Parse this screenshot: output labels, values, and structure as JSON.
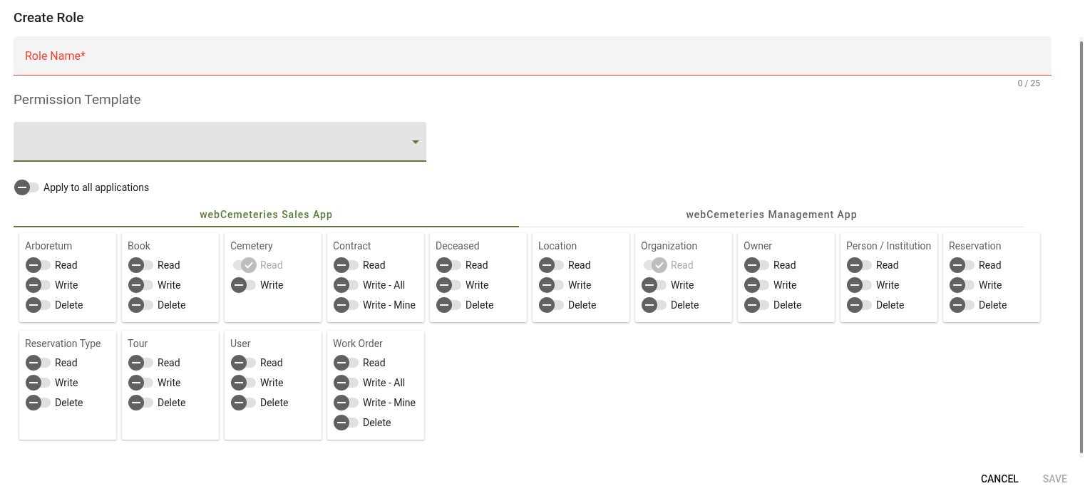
{
  "title": "Create Role",
  "role_name": {
    "label": "Role Name*",
    "counter": "0 / 25",
    "invalid": true
  },
  "permission_template": {
    "heading": "Permission Template"
  },
  "apply_all": {
    "label": "Apply to all applications",
    "checked": false
  },
  "tabs": [
    {
      "label": "webCemeteries Sales App",
      "selected": true
    },
    {
      "label": "webCemeteries Management App",
      "selected": false
    }
  ],
  "cards": [
    {
      "title": "Arboretum",
      "permissions": [
        {
          "label": "Read",
          "checked": false,
          "disabled": false
        },
        {
          "label": "Write",
          "checked": false,
          "disabled": false
        },
        {
          "label": "Delete",
          "checked": false,
          "disabled": false
        }
      ]
    },
    {
      "title": "Book",
      "permissions": [
        {
          "label": "Read",
          "checked": false,
          "disabled": false
        },
        {
          "label": "Write",
          "checked": false,
          "disabled": false
        },
        {
          "label": "Delete",
          "checked": false,
          "disabled": false
        }
      ]
    },
    {
      "title": "Cemetery",
      "permissions": [
        {
          "label": "Read",
          "checked": true,
          "disabled": true
        },
        {
          "label": "Write",
          "checked": false,
          "disabled": false
        }
      ]
    },
    {
      "title": "Contract",
      "permissions": [
        {
          "label": "Read",
          "checked": false,
          "disabled": false
        },
        {
          "label": "Write - All",
          "checked": false,
          "disabled": false
        },
        {
          "label": "Write - Mine",
          "checked": false,
          "disabled": false
        }
      ]
    },
    {
      "title": "Deceased",
      "permissions": [
        {
          "label": "Read",
          "checked": false,
          "disabled": false
        },
        {
          "label": "Write",
          "checked": false,
          "disabled": false
        },
        {
          "label": "Delete",
          "checked": false,
          "disabled": false
        }
      ]
    },
    {
      "title": "Location",
      "permissions": [
        {
          "label": "Read",
          "checked": false,
          "disabled": false
        },
        {
          "label": "Write",
          "checked": false,
          "disabled": false
        },
        {
          "label": "Delete",
          "checked": false,
          "disabled": false
        }
      ]
    },
    {
      "title": "Organization",
      "permissions": [
        {
          "label": "Read",
          "checked": true,
          "disabled": true
        },
        {
          "label": "Write",
          "checked": false,
          "disabled": false
        },
        {
          "label": "Delete",
          "checked": false,
          "disabled": false
        }
      ]
    },
    {
      "title": "Owner",
      "permissions": [
        {
          "label": "Read",
          "checked": false,
          "disabled": false
        },
        {
          "label": "Write",
          "checked": false,
          "disabled": false
        },
        {
          "label": "Delete",
          "checked": false,
          "disabled": false
        }
      ]
    },
    {
      "title": "Person / Institution",
      "permissions": [
        {
          "label": "Read",
          "checked": false,
          "disabled": false
        },
        {
          "label": "Write",
          "checked": false,
          "disabled": false
        },
        {
          "label": "Delete",
          "checked": false,
          "disabled": false
        }
      ]
    },
    {
      "title": "Reservation",
      "permissions": [
        {
          "label": "Read",
          "checked": false,
          "disabled": false
        },
        {
          "label": "Write",
          "checked": false,
          "disabled": false
        },
        {
          "label": "Delete",
          "checked": false,
          "disabled": false
        }
      ]
    },
    {
      "title": "Reservation Type",
      "permissions": [
        {
          "label": "Read",
          "checked": false,
          "disabled": false
        },
        {
          "label": "Write",
          "checked": false,
          "disabled": false
        },
        {
          "label": "Delete",
          "checked": false,
          "disabled": false
        }
      ]
    },
    {
      "title": "Tour",
      "permissions": [
        {
          "label": "Read",
          "checked": false,
          "disabled": false
        },
        {
          "label": "Write",
          "checked": false,
          "disabled": false
        },
        {
          "label": "Delete",
          "checked": false,
          "disabled": false
        }
      ]
    },
    {
      "title": "User",
      "permissions": [
        {
          "label": "Read",
          "checked": false,
          "disabled": false
        },
        {
          "label": "Write",
          "checked": false,
          "disabled": false
        },
        {
          "label": "Delete",
          "checked": false,
          "disabled": false
        }
      ]
    },
    {
      "title": "Work Order",
      "permissions": [
        {
          "label": "Read",
          "checked": false,
          "disabled": false
        },
        {
          "label": "Write - All",
          "checked": false,
          "disabled": false
        },
        {
          "label": "Write - Mine",
          "checked": false,
          "disabled": false
        },
        {
          "label": "Delete",
          "checked": false,
          "disabled": false
        }
      ]
    }
  ],
  "buttons": [
    {
      "label": "CANCEL",
      "disabled": false
    },
    {
      "label": "SAVE",
      "disabled": true
    }
  ]
}
